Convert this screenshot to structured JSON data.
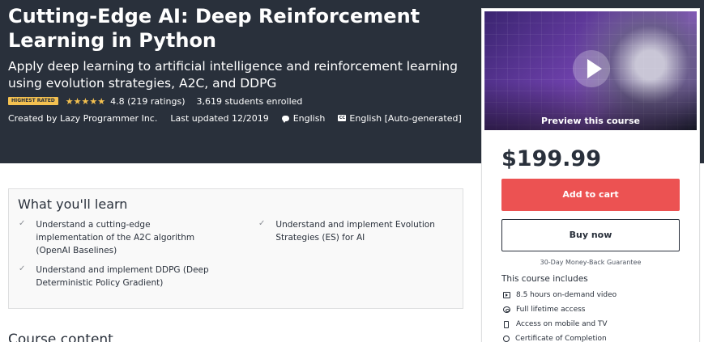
{
  "course": {
    "title": "Cutting-Edge AI: Deep Reinforcement Learning in Python",
    "subtitle": "Apply deep learning to artificial intelligence and reinforcement learning using evolution strategies, A2C, and DDPG",
    "badge": "HIGHEST RATED",
    "stars": "★★★★★",
    "rating_value": "4.8",
    "rating_count": "(219 ratings)",
    "students": "3,619 students enrolled",
    "created_by": "Created by Lazy Programmer Inc.",
    "last_updated": "Last updated 12/2019",
    "language": "English",
    "captions": "English [Auto-generated]"
  },
  "sidebar": {
    "preview_label": "Preview this course",
    "price": "$199.99",
    "add_to_cart": "Add to cart",
    "buy_now": "Buy now",
    "guarantee": "30-Day Money-Back Guarantee",
    "includes_title": "This course includes",
    "includes": [
      {
        "label": "8.5 hours on-demand video",
        "icon": "video-icon"
      },
      {
        "label": "Full lifetime access",
        "icon": "infinity-icon"
      },
      {
        "label": "Access on mobile and TV",
        "icon": "mobile-icon"
      },
      {
        "label": "Certificate of Completion",
        "icon": "certificate-icon"
      }
    ]
  },
  "learn": {
    "title": "What you'll learn",
    "items": [
      "Understand a cutting-edge implementation of the A2C algorithm (OpenAI Baselines)",
      "Understand and implement Evolution Strategies (ES) for AI",
      "Understand and implement DDPG (Deep Deterministic Policy Gradient)"
    ]
  },
  "content": {
    "heading": "Course content"
  },
  "colors": {
    "hero_bg": "#29303b",
    "badge_bg": "#f4c150",
    "star": "#f4c150",
    "add_to_cart_bg": "#ec5252"
  }
}
